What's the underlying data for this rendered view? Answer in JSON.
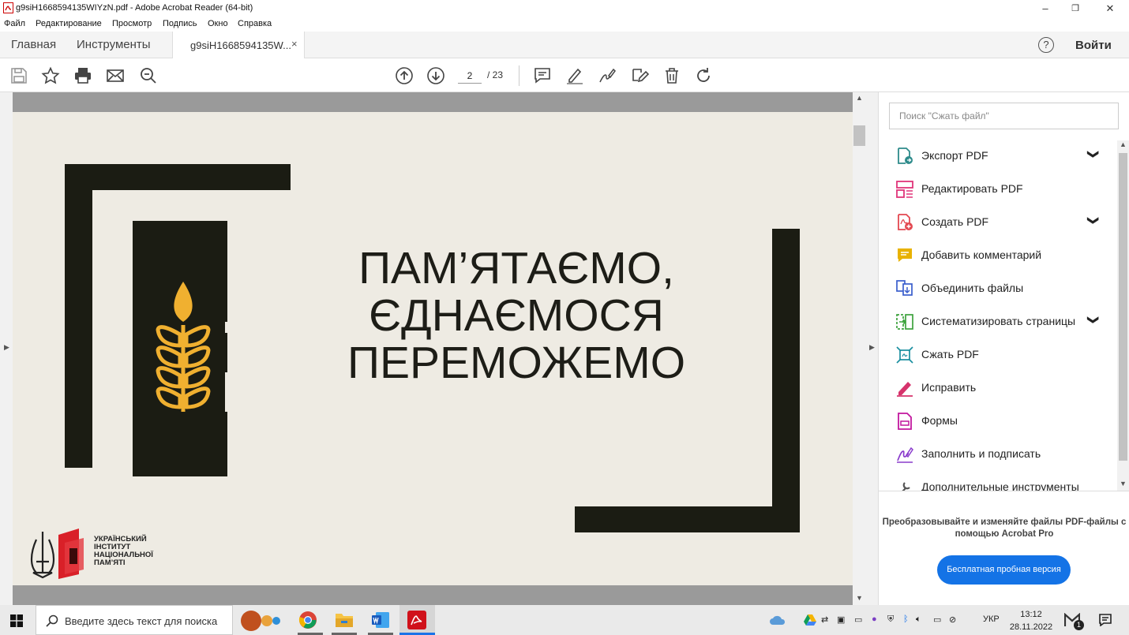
{
  "window": {
    "title": "g9siH1668594135WIYzN.pdf - Adobe Acrobat Reader (64-bit)",
    "controls": [
      "–",
      "❐",
      "✕"
    ]
  },
  "menu": [
    "Файл",
    "Редактирование",
    "Просмотр",
    "Подпись",
    "Окно",
    "Справка"
  ],
  "tabs": {
    "home": "Главная",
    "tools": "Инструменты",
    "doc": "g9siH1668594135W...",
    "close": "×"
  },
  "header": {
    "help": "?",
    "signin": "Войти"
  },
  "toolbar": {
    "page_current": "2",
    "page_total": "/ 23"
  },
  "page": {
    "slogan": "ПАМ’ЯТАЄМО,\nЄДНАЄМОСЯ\nПЕРЕМОЖЕМО",
    "logo_text": "УКРАЇНСЬКИЙ\nІНСТИТУТ\nНАЦІОНАЛЬНОЇ\nПАМ’ЯТІ",
    "colors": {
      "background": "#eeebe3",
      "frame": "#1b1c13",
      "wheat": "#f0b030"
    }
  },
  "panel": {
    "search_placeholder": "Поиск \"Сжать файл\"",
    "tools": [
      {
        "label": "Экспорт PDF",
        "icon": "export-pdf-icon",
        "color": "#2e8b8b",
        "chevron": "❯"
      },
      {
        "label": "Редактировать PDF",
        "icon": "edit-pdf-icon",
        "color": "#e0357a",
        "chevron": ""
      },
      {
        "label": "Создать PDF",
        "icon": "create-pdf-icon",
        "color": "#e34850",
        "chevron": "❯"
      },
      {
        "label": "Добавить комментарий",
        "icon": "comment-icon",
        "color": "#e8b200",
        "chevron": ""
      },
      {
        "label": "Объединить файлы",
        "icon": "combine-files-icon",
        "color": "#3a5fcd",
        "chevron": ""
      },
      {
        "label": "Систематизировать страницы",
        "icon": "organize-pages-icon",
        "color": "#3ea33e",
        "chevron": "❯"
      },
      {
        "label": "Сжать PDF",
        "icon": "compress-pdf-icon",
        "color": "#1a8fa0",
        "chevron": ""
      },
      {
        "label": "Исправить",
        "icon": "fill-sign-red-icon",
        "color": "#d6336c",
        "chevron": ""
      },
      {
        "label": "Формы",
        "icon": "forms-icon",
        "color": "#c2179e",
        "chevron": ""
      },
      {
        "label": "Заполнить и подписать",
        "icon": "fill-and-sign-icon",
        "color": "#8a3ccc",
        "chevron": ""
      },
      {
        "label": "Дополнительные инструменты",
        "icon": "more-tools-icon",
        "color": "#555555",
        "chevron": ""
      }
    ],
    "promo_text": "Преобразовывайте и изменяйте файлы PDF-файлы с помощью Acrobat Pro",
    "promo_button": "Бесплатная пробная версия"
  },
  "taskbar": {
    "search_placeholder": "Введите здесь текст для поиска",
    "lang": "УКР",
    "time": "13:12",
    "date": "28.11.2022",
    "badge": "1"
  }
}
